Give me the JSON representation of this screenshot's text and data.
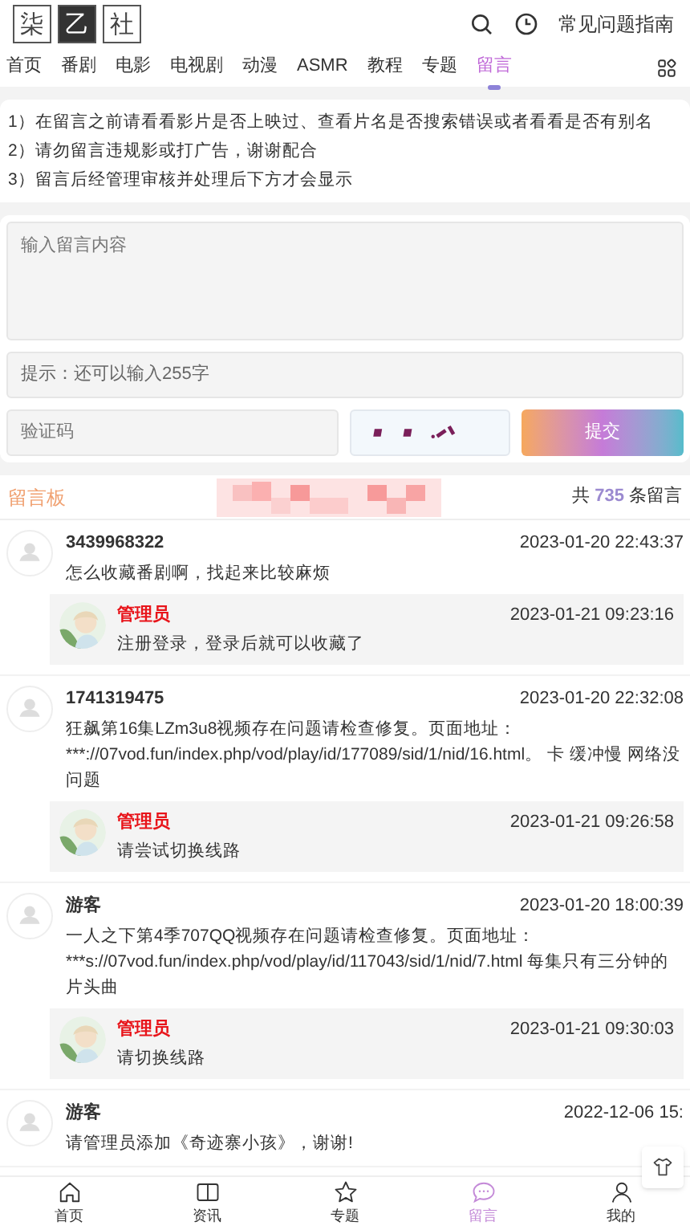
{
  "header": {
    "logo": [
      "柒",
      "乙",
      "社"
    ],
    "guide_link": "常见问题指南"
  },
  "nav": {
    "tabs": [
      {
        "label": "首页",
        "selected": false
      },
      {
        "label": "番剧",
        "selected": false
      },
      {
        "label": "电影",
        "selected": false
      },
      {
        "label": "电视剧",
        "selected": false
      },
      {
        "label": "动漫",
        "selected": false
      },
      {
        "label": "ASMR",
        "selected": false
      },
      {
        "label": "教程",
        "selected": false
      },
      {
        "label": "专题",
        "selected": false
      },
      {
        "label": "留言",
        "selected": true
      }
    ]
  },
  "notes": [
    "1）在留言之前请看看影片是否上映过、查看片名是否搜索错误或者看看是否有别名",
    "2）请勿留言违规影或打广告，谢谢配合",
    "3）留言后经管理审核并处理后下方才会显示"
  ],
  "form": {
    "message": {
      "placeholder": "输入留言内容"
    },
    "hint": "提示：还可以输入255字",
    "captcha": {
      "placeholder": "验证码"
    },
    "submit": "提交"
  },
  "board": {
    "title": "留言板",
    "count_prefix": "共",
    "count": "735",
    "count_suffix": "条留言"
  },
  "comments": [
    {
      "name": "3439968322",
      "time": "2023-01-20 22:43:37",
      "text": "怎么收藏番剧啊，找起来比较麻烦",
      "reply": {
        "name": "管理员",
        "time": "2023-01-21 09:23:16",
        "text": "注册登录，登录后就可以收藏了"
      }
    },
    {
      "name": "1741319475",
      "time": "2023-01-20 22:32:08",
      "text": "狂飙第16集LZm3u8视频存在问题请检查修复。页面地址：***://07vod.fun/index.php/vod/play/id/177089/sid/1/nid/16.html。 卡 缓冲慢 网络没问题",
      "reply": {
        "name": "管理员",
        "time": "2023-01-21 09:26:58",
        "text": "请尝试切换线路"
      }
    },
    {
      "name": "游客",
      "time": "2023-01-20 18:00:39",
      "text": "一人之下第4季707QQ视频存在问题请检查修复。页面地址：***s://07vod.fun/index.php/vod/play/id/117043/sid/1/nid/7.html 每集只有三分钟的片头曲",
      "reply": {
        "name": "管理员",
        "time": "2023-01-21 09:30:03",
        "text": "请切换线路"
      }
    },
    {
      "name": "游客",
      "time": "2022-12-06 15:",
      "text": "请管理员添加《奇迹寨小孩》，谢谢!"
    }
  ],
  "bottom_nav": [
    {
      "kind": "home",
      "label": "首页",
      "selected": false
    },
    {
      "kind": "news",
      "label": "资讯",
      "selected": false
    },
    {
      "kind": "topic",
      "label": "专题",
      "selected": false
    },
    {
      "kind": "message",
      "label": "留言",
      "selected": true
    },
    {
      "kind": "profile",
      "label": "我的",
      "selected": false
    }
  ]
}
